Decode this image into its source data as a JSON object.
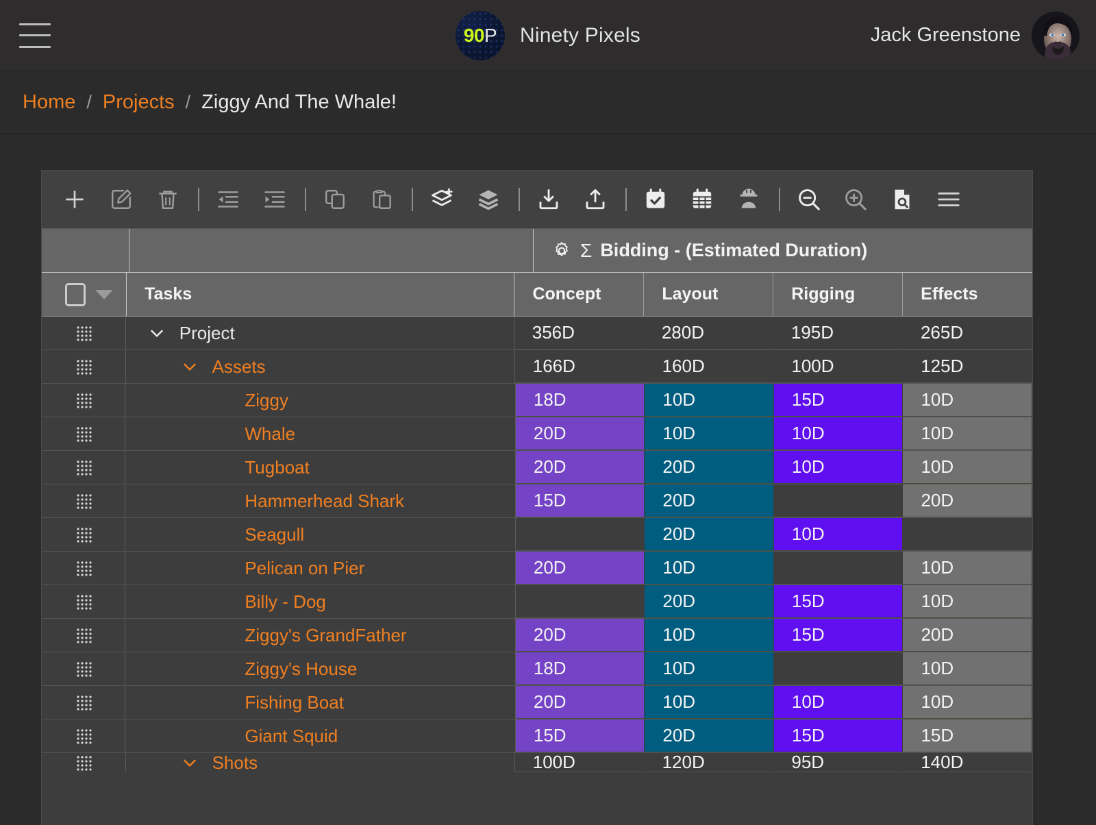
{
  "app": {
    "logo_badge_90": "90",
    "logo_badge_p": "P",
    "brand_name": "Ninety Pixels",
    "user_name": "Jack Greenstone",
    "menu_icon": "hamburger-icon"
  },
  "breadcrumb": {
    "items": [
      "Home",
      "Projects",
      "Ziggy And The Whale!"
    ],
    "separator": "/"
  },
  "toolbar": {
    "buttons": [
      {
        "name": "add-task-button",
        "icon": "plus-icon"
      },
      {
        "name": "edit-task-button",
        "icon": "pencil-square-icon"
      },
      {
        "name": "delete-task-button",
        "icon": "trash-icon"
      },
      {
        "name": "outdent-button",
        "icon": "outdent-icon"
      },
      {
        "name": "indent-button",
        "icon": "indent-icon"
      },
      {
        "name": "copy-button",
        "icon": "copy-icon"
      },
      {
        "name": "paste-button",
        "icon": "clipboard-paste-icon"
      },
      {
        "name": "add-layer-button",
        "icon": "layers-plus-icon"
      },
      {
        "name": "layers-button",
        "icon": "layers-icon"
      },
      {
        "name": "import-button",
        "icon": "download-tray-icon"
      },
      {
        "name": "export-button",
        "icon": "upload-tray-icon"
      },
      {
        "name": "tasks-calendar-button",
        "icon": "calendar-check-icon"
      },
      {
        "name": "calendar-button",
        "icon": "calendar-grid-icon"
      },
      {
        "name": "resources-button",
        "icon": "hardhat-worker-icon"
      },
      {
        "name": "zoom-out-button",
        "icon": "magnifier-minus-icon"
      },
      {
        "name": "zoom-in-button",
        "icon": "magnifier-plus-icon"
      },
      {
        "name": "report-button",
        "icon": "document-search-icon"
      },
      {
        "name": "overflow-menu-button",
        "icon": "hamburger-menu-icon"
      }
    ]
  },
  "table": {
    "group_header": {
      "settings_icon": "gear-icon",
      "sigma_icon": "Σ",
      "label": "Bidding - (Estimated Duration)"
    },
    "columns": {
      "tasks": "Tasks",
      "data": [
        "Concept",
        "Layout",
        "Rigging",
        "Effects"
      ]
    },
    "column_colors": {
      "Concept": "#7443c6",
      "Layout": "#015d80",
      "Rigging": "#6010f0",
      "Effects": "#717171"
    },
    "accent_color": "#ef7f21",
    "rows": [
      {
        "name": "Project",
        "level": 0,
        "expandable": true,
        "expanded": true,
        "summary": true,
        "root": true,
        "values": [
          "356D",
          "280D",
          "195D",
          "265D"
        ]
      },
      {
        "name": "Assets",
        "level": 1,
        "expandable": true,
        "expanded": true,
        "summary": true,
        "root": false,
        "values": [
          "166D",
          "160D",
          "100D",
          "125D"
        ]
      },
      {
        "name": "Ziggy",
        "level": 2,
        "expandable": false,
        "summary": false,
        "values": [
          "18D",
          "10D",
          "15D",
          "10D"
        ]
      },
      {
        "name": "Whale",
        "level": 2,
        "expandable": false,
        "summary": false,
        "values": [
          "20D",
          "10D",
          "10D",
          "10D"
        ]
      },
      {
        "name": "Tugboat",
        "level": 2,
        "expandable": false,
        "summary": false,
        "values": [
          "20D",
          "20D",
          "10D",
          "10D"
        ]
      },
      {
        "name": "Hammerhead Shark",
        "level": 2,
        "expandable": false,
        "summary": false,
        "values": [
          "15D",
          "20D",
          "",
          "20D"
        ]
      },
      {
        "name": "Seagull",
        "level": 2,
        "expandable": false,
        "summary": false,
        "values": [
          "",
          "20D",
          "10D",
          ""
        ]
      },
      {
        "name": "Pelican on Pier",
        "level": 2,
        "expandable": false,
        "summary": false,
        "values": [
          "20D",
          "10D",
          "",
          "10D"
        ]
      },
      {
        "name": "Billy - Dog",
        "level": 2,
        "expandable": false,
        "summary": false,
        "values": [
          "",
          "20D",
          "15D",
          "10D"
        ]
      },
      {
        "name": "Ziggy's GrandFather",
        "level": 2,
        "expandable": false,
        "summary": false,
        "values": [
          "20D",
          "10D",
          "15D",
          "20D"
        ]
      },
      {
        "name": "Ziggy's House",
        "level": 2,
        "expandable": false,
        "summary": false,
        "values": [
          "18D",
          "10D",
          "",
          "10D"
        ]
      },
      {
        "name": "Fishing Boat",
        "level": 2,
        "expandable": false,
        "summary": false,
        "values": [
          "20D",
          "10D",
          "10D",
          "10D"
        ]
      },
      {
        "name": "Giant Squid",
        "level": 2,
        "expandable": false,
        "summary": false,
        "values": [
          "15D",
          "20D",
          "15D",
          "15D"
        ]
      },
      {
        "name": "Shots",
        "level": 1,
        "expandable": true,
        "expanded": true,
        "summary": true,
        "root": false,
        "values": [
          "100D",
          "120D",
          "95D",
          "140D"
        ]
      }
    ]
  }
}
